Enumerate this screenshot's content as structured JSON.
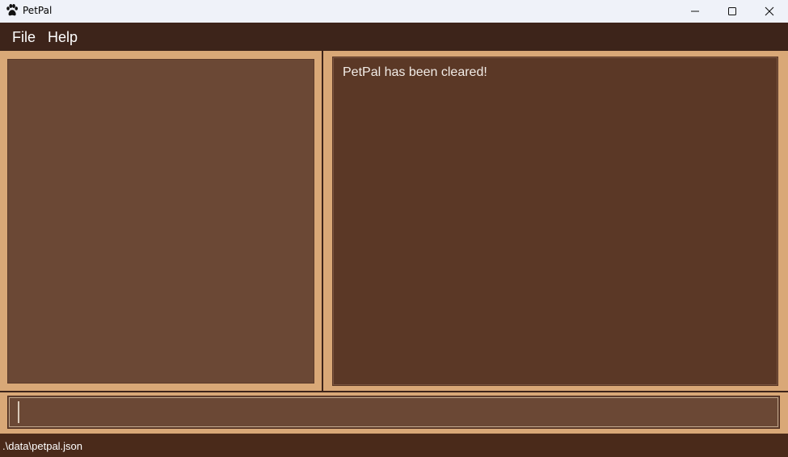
{
  "window": {
    "title": "PetPal",
    "icon": "paw-icon",
    "controls": [
      "minimize-icon",
      "maximize-icon",
      "close-icon"
    ]
  },
  "menu": {
    "items": [
      {
        "label": "File"
      },
      {
        "label": "Help"
      }
    ]
  },
  "result_display": {
    "message": "PetPal has been cleared!"
  },
  "command_box": {
    "value": "",
    "placeholder": ""
  },
  "status_bar": {
    "path": ".\\data\\petpal.json"
  },
  "colors": {
    "menubar": "#3d241a",
    "background": "#d9a877",
    "list_panel": "#6b4835",
    "result_panel": "#5b3826",
    "status_bar": "#4a2a1a",
    "text": "#ffffff"
  }
}
